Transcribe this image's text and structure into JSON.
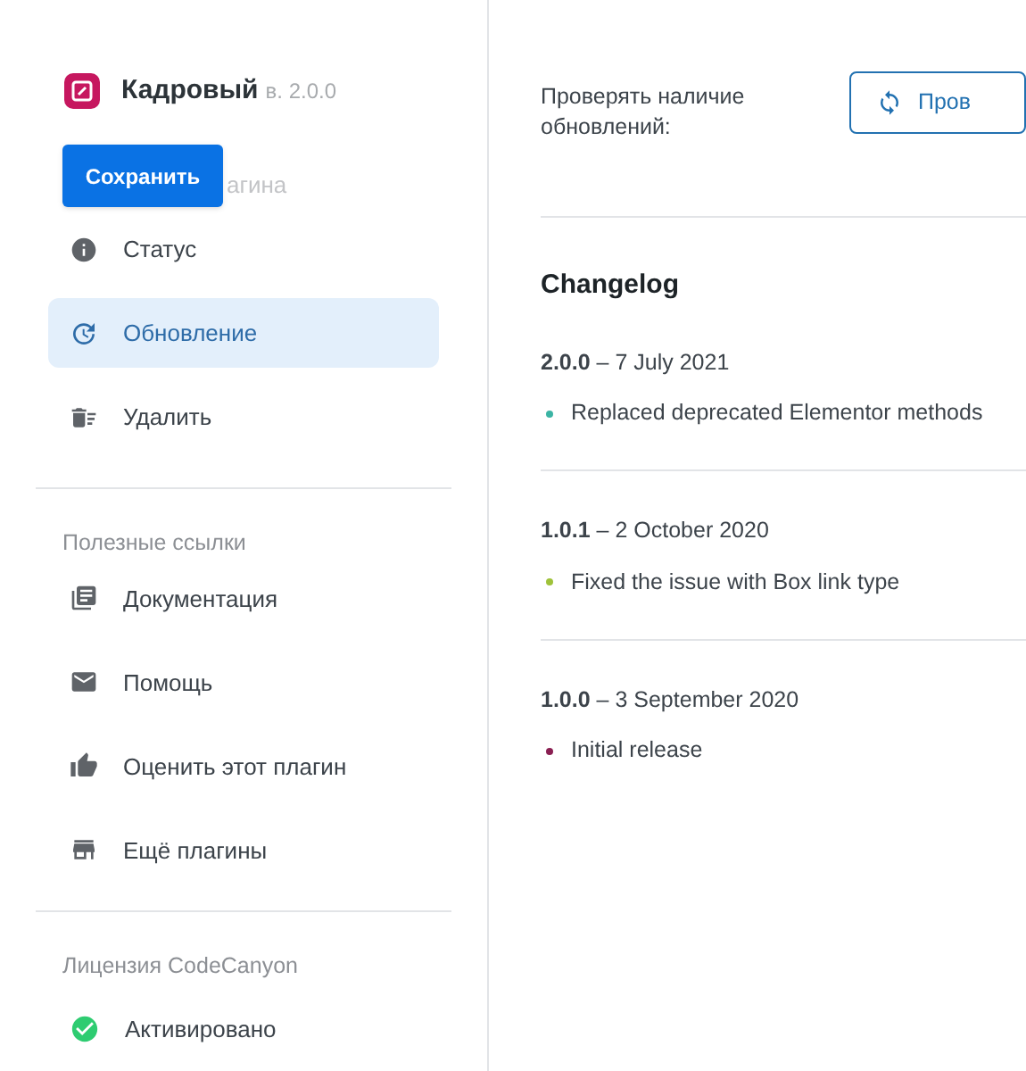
{
  "plugin": {
    "name": "Кадровый",
    "version": "в. 2.0.0",
    "save_button": "Сохранить",
    "hidden_label": "агина"
  },
  "nav": [
    {
      "kind": "info",
      "label": "Статус",
      "selected": false
    },
    {
      "kind": "update",
      "label": "Обновление",
      "selected": true
    },
    {
      "kind": "delete",
      "label": "Удалить",
      "selected": false
    }
  ],
  "links": {
    "heading": "Полезные ссылки",
    "items": [
      {
        "kind": "docs",
        "label": "Документация"
      },
      {
        "kind": "mail",
        "label": "Помощь"
      },
      {
        "kind": "like",
        "label": "Оценить этот плагин"
      },
      {
        "kind": "store",
        "label": "Ещё плагины"
      }
    ]
  },
  "license": {
    "heading": "Лицензия CodeCanyon",
    "status": "Активировано"
  },
  "check": {
    "label": "Проверять наличие обновлений:",
    "button": "Пров"
  },
  "changelog": {
    "title": "Changelog",
    "releases": [
      {
        "version": "2.0.0",
        "date": "– 7 July 2021",
        "changes": [
          {
            "text": "Replaced deprecated Elementor methods",
            "color": "#3bb4a4"
          }
        ]
      },
      {
        "version": "1.0.1",
        "date": "– 2 October 2020",
        "changes": [
          {
            "text": "Fixed the issue with Box link type",
            "color": "#9fc23a"
          }
        ]
      },
      {
        "version": "1.0.0",
        "date": "– 3 September 2020",
        "changes": [
          {
            "text": "Initial release",
            "color": "#8a1f52"
          }
        ]
      }
    ]
  }
}
